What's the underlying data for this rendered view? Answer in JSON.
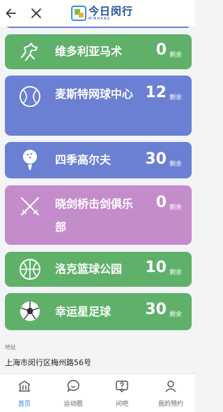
{
  "header": {
    "back_icon": "back-arrow-icon",
    "close_icon": "close-icon",
    "logo_main": "今日闵行",
    "logo_sub": "MINHANG"
  },
  "venues": [
    {
      "name": "维多利亚马术",
      "count": "0",
      "unit": "剩余",
      "color": "#5fb16a",
      "icon": "horse-icon"
    },
    {
      "name": "麦斯特网球中心",
      "count": "12",
      "unit": "剩余",
      "color": "#6b7fd3",
      "icon": "tennis-ball-icon"
    },
    {
      "name": "四季高尔夫",
      "count": "30",
      "unit": "剩余",
      "color": "#6b7fd3",
      "icon": "golf-ball-icon"
    },
    {
      "name": "晓剑桥击剑俱乐部",
      "count": "0",
      "unit": "剩余",
      "color": "#c48ccb",
      "icon": "fencing-icon"
    },
    {
      "name": "洛克篮球公园",
      "count": "10",
      "unit": "剩余",
      "color": "#5fb16a",
      "icon": "basketball-icon"
    },
    {
      "name": "幸运星足球",
      "count": "30",
      "unit": "剩余",
      "color": "#5fb16a",
      "icon": "soccer-ball-icon"
    }
  ],
  "address": {
    "label": "地址",
    "value": "上海市闵行区梅州路56号"
  },
  "nav": [
    {
      "label": "首页",
      "icon": "home-icon",
      "active": true
    },
    {
      "label": "运动圈",
      "icon": "chat-bubble-icon",
      "active": false
    },
    {
      "label": "问吧",
      "icon": "question-icon",
      "active": false
    },
    {
      "label": "我的预约",
      "icon": "user-icon",
      "active": false
    }
  ]
}
